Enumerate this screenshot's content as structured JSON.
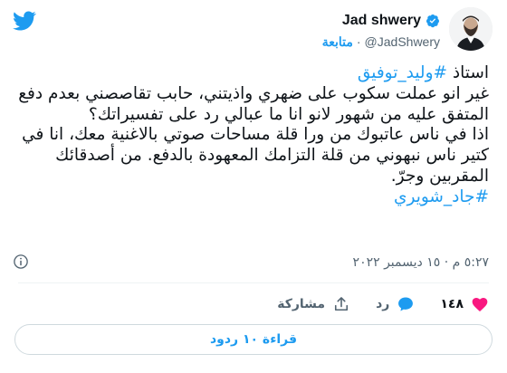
{
  "author": {
    "name": "Jad shwery",
    "handle": "@JadShwery",
    "follow_label": "متابعة",
    "separator": "·"
  },
  "tweet": {
    "line1_prefix": "استاذ ",
    "line1_hashtag": "#وليد_توفيق",
    "body": "غير انو عملت سكوب على ضهري واذيتني، حابب تقاصصني بعدم دفع المتفق عليه من شهور لانو انا ما عبالي رد على تفسيراتك؟",
    "body2": "اذا في ناس عاتبوك من ورا قلة مساحات صوتي بالاغنية معك، انا في كتير ناس نبهوني من قلة التزامك المعهودة بالدفع. من أصدقائك المقربين وجرّ.",
    "signature_hashtag": "#جاد_شويري"
  },
  "timestamp": "٥:٢٧ م · ١٥ ديسمبر ٢٠٢٢",
  "actions": {
    "like_count": "١٤٨",
    "reply_label": "رد",
    "share_label": "مشاركة"
  },
  "read_replies_label": "قراءة ١٠ ردود",
  "colors": {
    "accent": "#1d9bf0",
    "like": "#f91880",
    "text": "#0f1419",
    "muted": "#536471"
  }
}
